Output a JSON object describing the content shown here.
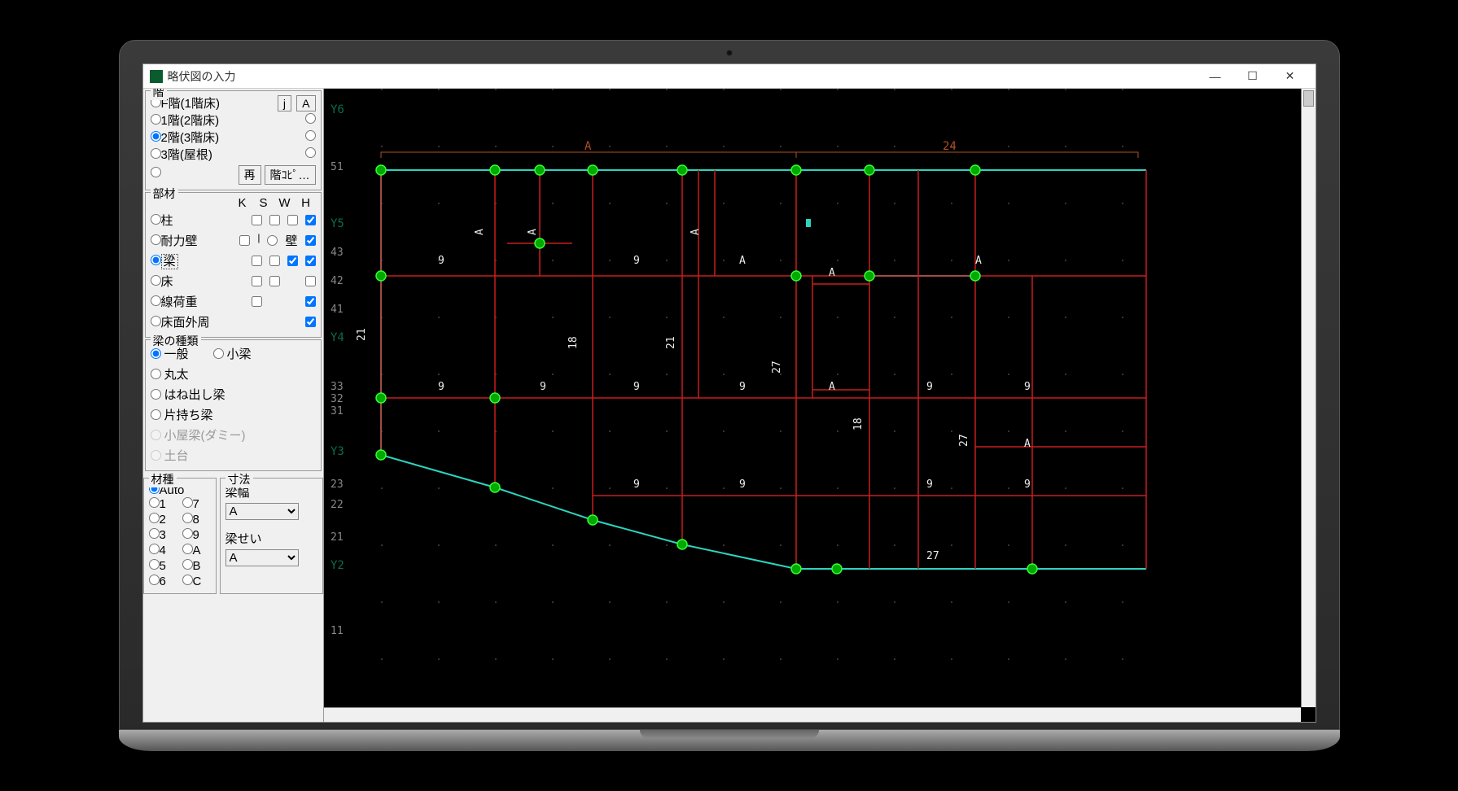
{
  "window": {
    "title": "略伏図の入力"
  },
  "floor": {
    "legend": "階",
    "options": [
      "F階(1階床)",
      "1階(2階床)",
      "2階(3階床)",
      "3階(屋根)"
    ],
    "selected": 2,
    "btn_j": "j",
    "btn_a": "A",
    "btn_re": "再",
    "btn_copy": "階ｺﾋﾟ…"
  },
  "member": {
    "legend": "部材",
    "cols": [
      "K",
      "S",
      "W",
      "H"
    ],
    "rows": [
      {
        "label": "柱",
        "extra": ""
      },
      {
        "label": "耐力壁",
        "extra": "壁"
      },
      {
        "label": "梁",
        "extra": ""
      },
      {
        "label": "床",
        "extra": ""
      },
      {
        "label": "線荷重",
        "extra": ""
      },
      {
        "label": "床面外周",
        "extra": ""
      }
    ],
    "selected": 2
  },
  "beamType": {
    "legend": "梁の種類",
    "options": [
      "一般",
      "小梁",
      "丸太",
      "はね出し梁",
      "片持ち梁",
      "小屋梁(ダミー)",
      "土台"
    ],
    "selected": 0
  },
  "material": {
    "legend": "材種",
    "auto": "Auto",
    "nums": [
      "1",
      "2",
      "3",
      "4",
      "5",
      "6"
    ],
    "letters": [
      "7",
      "8",
      "9",
      "A",
      "B",
      "C"
    ]
  },
  "dimension": {
    "legend": "寸法",
    "width_label": "梁幅",
    "width_value": "A",
    "height_label": "梁せい",
    "height_value": "A"
  },
  "canvas": {
    "y_labels": [
      "Y6",
      "Y5",
      "Y4",
      "Y3",
      "Y2"
    ],
    "y_nums": [
      "51",
      "43",
      "42",
      "41",
      "33",
      "32",
      "31",
      "23",
      "22",
      "21",
      "11"
    ],
    "top_dims": {
      "a": "A",
      "d24": "24"
    },
    "labels_A": "A",
    "labels_9": "9",
    "labels_18": "18",
    "labels_21": "21",
    "labels_27": "27"
  }
}
